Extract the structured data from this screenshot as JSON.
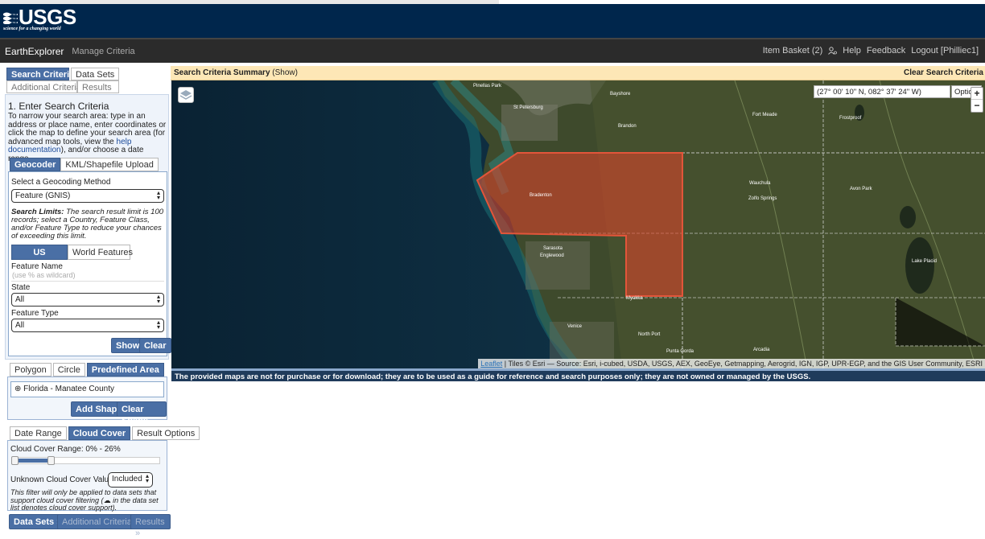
{
  "logo": {
    "word": "USGS",
    "tagline": "science for a changing world"
  },
  "nav": {
    "brand": "EarthExplorer",
    "manage": "Manage Criteria",
    "item_basket": "Item Basket (2)",
    "help": "Help",
    "feedback": "Feedback",
    "logout": "Logout [Philliec1]"
  },
  "main_tabs": [
    "Search Criteria",
    "Data Sets",
    "Additional Criteria",
    "Results"
  ],
  "criteria": {
    "heading": "1. Enter Search Criteria",
    "intro_before": "To narrow your search area: type in an address or place name, enter coordinates or click the map to define your search area (for advanced map tools, view the ",
    "intro_link": "help documentation",
    "intro_after": "), and/or choose a date range."
  },
  "geocoder": {
    "tabs": [
      "Geocoder",
      "KML/Shapefile Upload"
    ],
    "method_label": "Select a Geocoding Method",
    "method_value": "Feature (GNIS)",
    "limits_label": "Search Limits:",
    "limits_text": " The search result limit is 100 records; select a Country, Feature Class, and/or Feature Type to reduce your chances of exceeding this limit.",
    "feature_tabs": [
      "US Features",
      "World Features"
    ],
    "feature_name_label": "Feature Name",
    "feature_name_placeholder": "(use % as wildcard)",
    "state_label": "State",
    "state_value": "All",
    "type_label": "Feature Type",
    "type_value": "All",
    "show": "Show",
    "clear": "Clear"
  },
  "area": {
    "tabs": [
      "Polygon",
      "Circle",
      "Predefined Area"
    ],
    "selected": "Florida - Manatee County",
    "add_shape": "Add Shape",
    "clear_shape": "Clear Shape"
  },
  "cloud": {
    "tabs": [
      "Date Range",
      "Cloud Cover",
      "Result Options"
    ],
    "range_label": "Cloud Cover Range: 0% - 26%",
    "range_max_pct": 26,
    "unknown_label": "Unknown Cloud Cover Values",
    "unknown_value": "Included",
    "note_before": "This filter will only be applied to data sets that support cloud cover filtering (",
    "note_after": " in the data set list denotes cloud cover support)."
  },
  "bottom_buttons": [
    "Data Sets »",
    "Additional Criteria »",
    "Results »"
  ],
  "summary": {
    "title": "Search Criteria Summary",
    "show": "(Show)",
    "clear": "Clear Search Criteria"
  },
  "map": {
    "coords": "(27° 00' 10\" N, 082° 37' 24\" W)",
    "options": "Options",
    "zoom_in": "+",
    "zoom_out": "−",
    "attr_link": "Leaflet",
    "attr_text": " | Tiles © Esri — Source: Esri, i-cubed, USDA, USGS, AEX, GeoEye, Getmapping, Aerogrid, IGN, IGP, UPR-EGP, and the GIS User Community, ESRI",
    "labels": [
      "Pinellas Park",
      "St Petersburg",
      "Bayshore",
      "Brandon",
      "Fort Meade",
      "Frostproof",
      "Bradenton",
      "Zolfo Springs",
      "Wauchula",
      "Avon Park",
      "Sarasota",
      "Venice",
      "North Port",
      "Arcadia",
      "Lake Placid",
      "Punta Gorda",
      "Englewood",
      "Myakka"
    ]
  },
  "disclaimer": "The provided maps are not for purchase or for download; they are to be used as a guide for reference and search purposes only; they are not owned or managed by the USGS."
}
